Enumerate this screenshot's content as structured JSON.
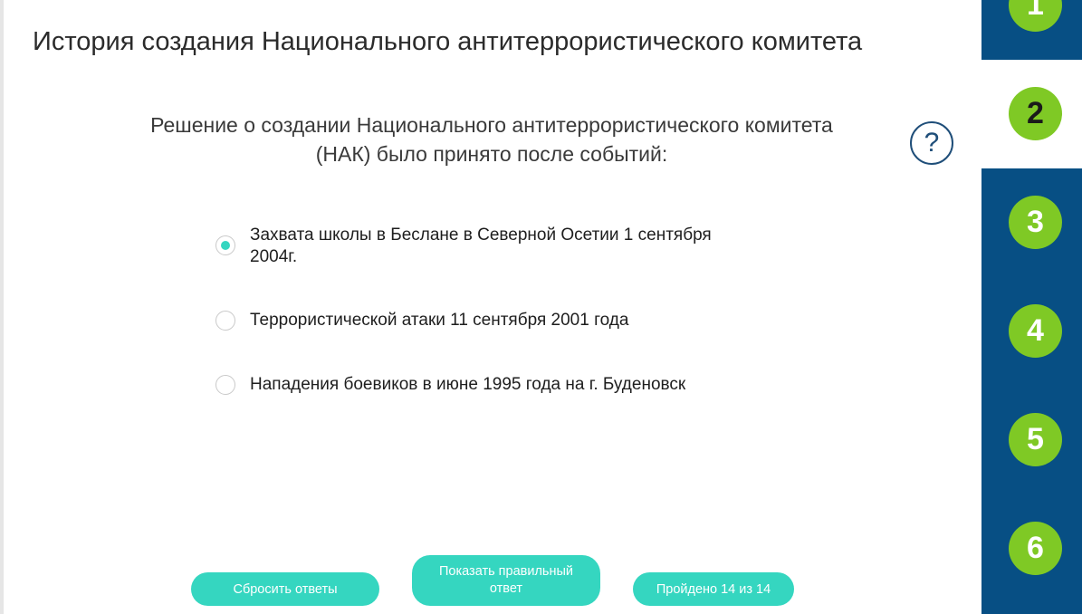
{
  "title": "История создания Национального антитеррористического комитета",
  "question": {
    "line1": "Решение о создании Национального  антитеррористического комитета",
    "line2": "(НАК) было принято после событий:"
  },
  "help_icon": "question-mark-circle-icon",
  "help_symbol": "?",
  "options": [
    {
      "label": "Захвата школы в Беслане в Северной Осетии 1 сентября 2004г.",
      "selected": true
    },
    {
      "label": "Террористической атаки 11 сентября 2001 года",
      "selected": false
    },
    {
      "label": "Нападения боевиков в июне 1995 года на г. Буденовск",
      "selected": false
    }
  ],
  "buttons": {
    "reset": "Сбросить ответы",
    "show_answer": "Показать правильный ответ",
    "progress": "Пройдено 14 из 14"
  },
  "steps": [
    {
      "label": "1",
      "active": false
    },
    {
      "label": "2",
      "active": true
    },
    {
      "label": "3",
      "active": false
    },
    {
      "label": "4",
      "active": false
    },
    {
      "label": "5",
      "active": false
    },
    {
      "label": "6",
      "active": false
    }
  ],
  "colors": {
    "accent": "#35d6c0",
    "sidebar_blue": "#074f84",
    "step_green": "#7fc925",
    "help_blue": "#1f4e79"
  }
}
